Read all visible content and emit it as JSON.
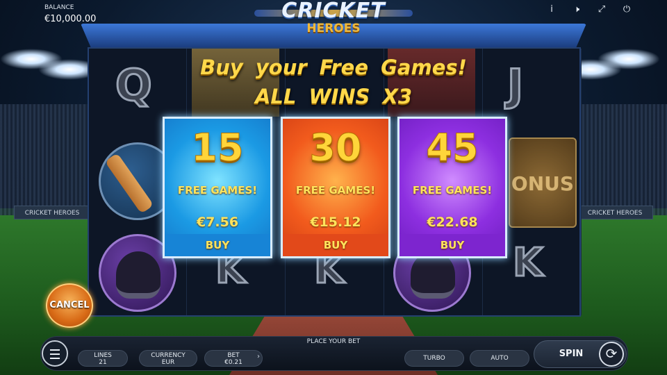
{
  "header": {
    "balance_label": "BALANCE",
    "balance_value": "€10,000.00",
    "icons": [
      "info-icon",
      "sound-icon",
      "fullscreen-icon",
      "power-icon"
    ],
    "icon_glyphs": {
      "info": "i",
      "sound": "🕨",
      "fullscreen": "⤢",
      "power": "⏻"
    }
  },
  "logo": {
    "title": "CRICKET",
    "subtitle": "HEROES"
  },
  "stadium": {
    "board_left": "CRICKET HEROES",
    "board_right": "CRICKET HEROES"
  },
  "reels": {
    "letters": {
      "q": "Q",
      "j": "J",
      "k1": "K",
      "k2": "K",
      "k3": "K"
    },
    "bonus": "ONUS"
  },
  "buy_feature": {
    "headline": "Buy your Free Games!",
    "subheadline": "ALL WINS X3",
    "options": [
      {
        "count": "15",
        "label": "FREE GAMES!",
        "price": "€7.56",
        "buy": "BUY",
        "color": "#1b9ae4"
      },
      {
        "count": "30",
        "label": "FREE GAMES!",
        "price": "€15.12",
        "buy": "BUY",
        "color": "#f25b1d"
      },
      {
        "count": "45",
        "label": "FREE GAMES!",
        "price": "€22.68",
        "buy": "BUY",
        "color": "#8d2fe0"
      }
    ],
    "cancel": "CANCEL"
  },
  "controls": {
    "place_bet": "PLACE YOUR BET",
    "lines_label": "LINES",
    "lines_value": "21",
    "currency_label": "CURRENCY",
    "currency_value": "EUR",
    "bet_label": "BET",
    "bet_value": "€0.21",
    "bet_arrow": "›",
    "turbo": "TURBO",
    "auto": "AUTO",
    "spin": "SPIN",
    "spin_glyph": "⟳"
  }
}
